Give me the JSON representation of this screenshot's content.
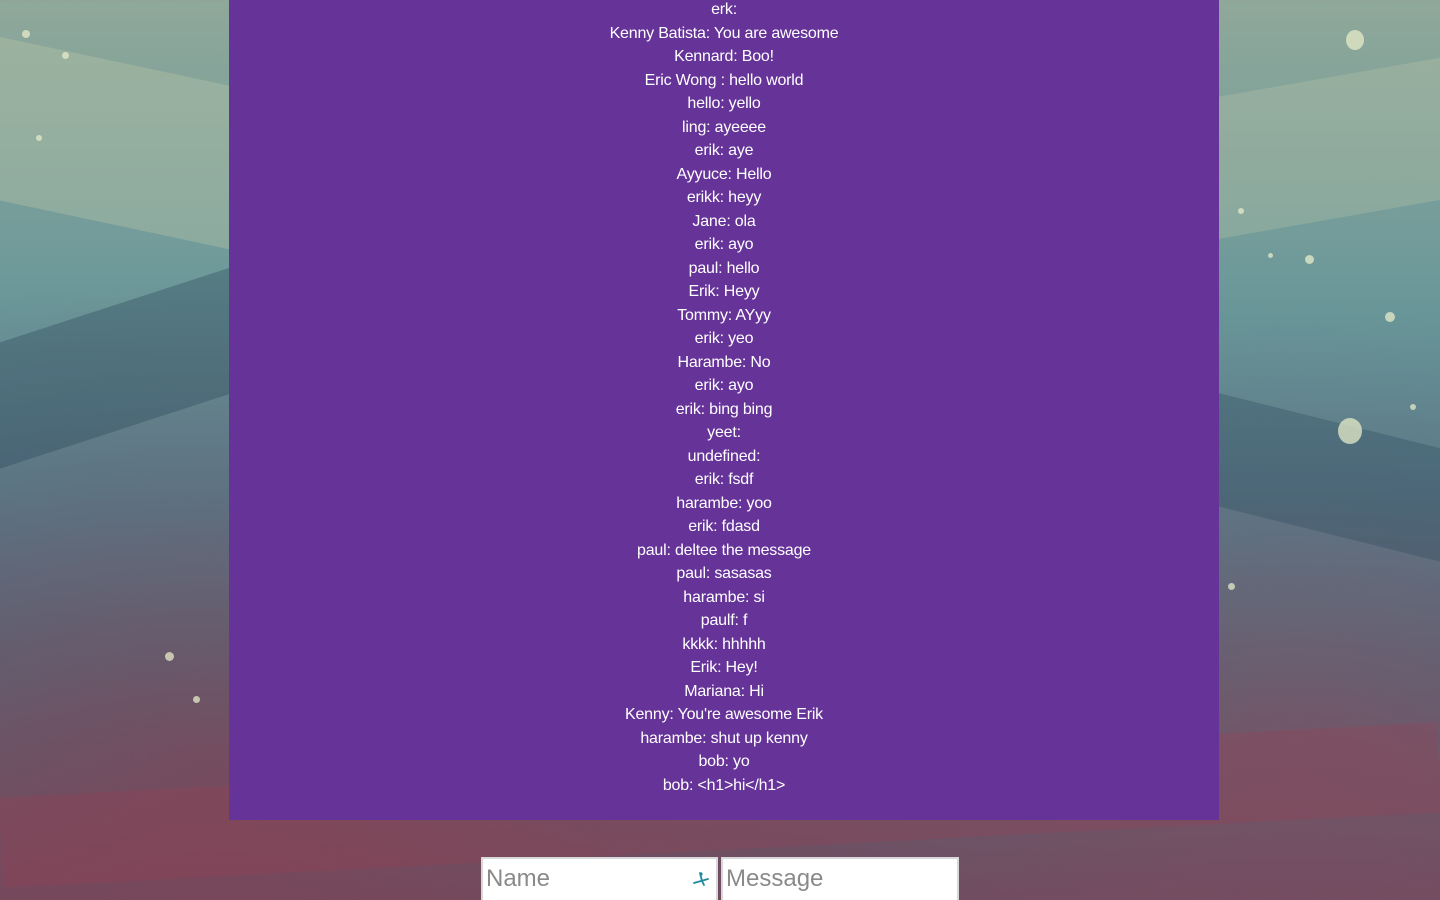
{
  "chat": {
    "messages": [
      "erk:",
      "Kenny Batista: You are awesome",
      "Kennard: Boo!",
      "Eric Wong : hello world",
      "hello: yello",
      "ling: ayeeee",
      "erik: aye",
      "Ayyuce: Hello",
      "erikk: heyy",
      "Jane: ola",
      "erik: ayo",
      "paul: hello",
      "Erik: Heyy",
      "Tommy: AYyy",
      "erik: yeo",
      "Harambe: No",
      "erik: ayo",
      "erik: bing bing",
      "yeet:",
      "undefined:",
      "erik: fsdf",
      "harambe: yoo",
      "erik: fdasd",
      "paul: deltee the message",
      "paul: sasasas",
      "harambe: si",
      "paulf: f",
      "kkkk: hhhhh",
      "Erik: Hey!",
      "Mariana: Hi",
      "Kenny: You're awesome Erik",
      "harambe: shut up kenny",
      "bob: yo",
      "bob: <h1>hi</h1>"
    ],
    "panel_color": "#663399",
    "text_color": "#ffffff"
  },
  "compose": {
    "name_placeholder": "Name",
    "name_value": "",
    "message_placeholder": "Message",
    "message_value": "",
    "autofill_icon": "contact-autofill-icon"
  }
}
